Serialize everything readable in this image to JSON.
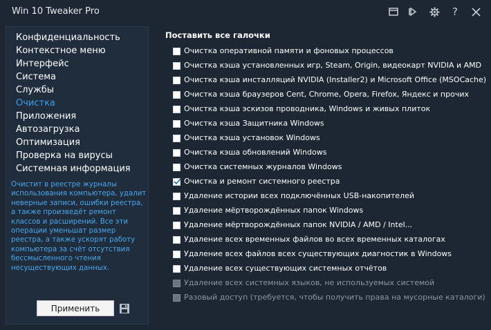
{
  "window": {
    "title": "Win 10 Tweaker Pro"
  },
  "sidebar": {
    "items": [
      {
        "label": "Конфиденциальность",
        "active": false
      },
      {
        "label": "Контекстное меню",
        "active": false
      },
      {
        "label": "Интерфейс",
        "active": false
      },
      {
        "label": "Система",
        "active": false
      },
      {
        "label": "Службы",
        "active": false
      },
      {
        "label": "Очистка",
        "active": true
      },
      {
        "label": "Приложения",
        "active": false
      },
      {
        "label": "Автозагрузка",
        "active": false
      },
      {
        "label": "Оптимизация",
        "active": false
      },
      {
        "label": "Проверка на вирусы",
        "active": false
      },
      {
        "label": "Системная информация",
        "active": false
      }
    ],
    "description": "Очистит в реестре журналы использования компьютера, удалит неверные записи, ошибки реестра, а также произведёт ремонт классов и расширений. Все эти операции уменьшат размер реестра, а также ускорят работу компьютера за счёт отсутствия бессмысленного чтения несуществующих данных.",
    "apply_label": "Применить"
  },
  "main": {
    "select_all": "Поставить все галочки",
    "options": [
      {
        "label": "Очистка оперативной памяти и фоновых процессов",
        "checked": false,
        "disabled": false
      },
      {
        "label": "Очистка кэша установленных игр, Steam, Origin, видеокарт NVIDIA и AMD",
        "checked": false,
        "disabled": false
      },
      {
        "label": "Очистка кэша инсталляций NVIDIA (Installer2) и Microsoft Office (MSOCache)",
        "checked": false,
        "disabled": false
      },
      {
        "label": "Очистка кэша браузеров Cent, Chrome, Opera, Firefox, Яндекс и прочих",
        "checked": false,
        "disabled": false
      },
      {
        "label": "Очистка кэша эскизов проводника, Windows и живых плиток",
        "checked": false,
        "disabled": false
      },
      {
        "label": "Очистка кэша Защитника Windows",
        "checked": false,
        "disabled": false
      },
      {
        "label": "Очистка кэша установок Windows",
        "checked": false,
        "disabled": false
      },
      {
        "label": "Очистка кэша обновлений Windows",
        "checked": false,
        "disabled": false
      },
      {
        "label": "Очистка системных журналов Windows",
        "checked": false,
        "disabled": false
      },
      {
        "label": "Очистка и ремонт системного реестра",
        "checked": true,
        "disabled": false
      },
      {
        "label": "Удаление истории всех подключённых USB-накопителей",
        "checked": false,
        "disabled": false
      },
      {
        "label": "Удаление мёртворождённых папок Windows",
        "checked": false,
        "disabled": false
      },
      {
        "label": "Удаление мёртворождённых папок NVIDIA / AMD / Intel...",
        "checked": false,
        "disabled": false
      },
      {
        "label": "Удаление всех временных файлов во всех временных каталогах",
        "checked": false,
        "disabled": false
      },
      {
        "label": "Удаление всех файлов всех существующих диагностик в Windows",
        "checked": false,
        "disabled": false
      },
      {
        "label": "Удаление всех существующих системных отчётов",
        "checked": false,
        "disabled": false
      },
      {
        "label": "Удаление всех системных языков, не используемых системой",
        "checked": false,
        "disabled": true
      },
      {
        "label": "Разовый доступ (требуется, чтобы получить права на мусорные каталоги)",
        "checked": false,
        "disabled": true
      }
    ]
  },
  "icons": {
    "titlebar": [
      "apps-icon",
      "play-icon",
      "gear-icon",
      "help-icon",
      "close-icon"
    ],
    "save": "save-icon"
  },
  "colors": {
    "background": "#1c2733",
    "accent": "#3aa0e8",
    "description": "#4aa6ea"
  }
}
